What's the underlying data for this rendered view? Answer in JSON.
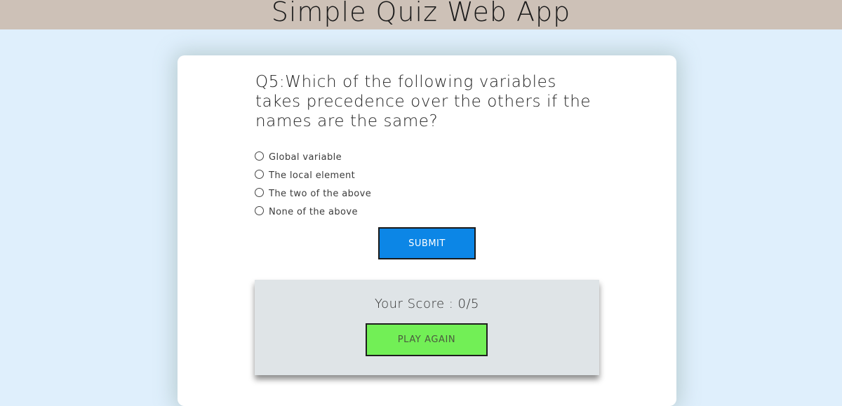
{
  "header": {
    "title": "Simple Quiz Web App"
  },
  "quiz": {
    "question": "Q5:Which of the following variables takes precedence over the others if the names are the same?",
    "options": [
      "Global variable",
      "The local element",
      "The two of the above",
      "None of the above"
    ],
    "submit_label": "SUBMIT"
  },
  "result": {
    "score_text": "Your Score : 0/5",
    "play_again_label": "PLAY AGAIN"
  },
  "colors": {
    "header_bg": "#cdc1b7",
    "page_bg": "#dfeffc",
    "submit_bg": "#0c86e6",
    "play_again_bg": "#72ef56",
    "score_box_bg": "#dfe4e7"
  }
}
